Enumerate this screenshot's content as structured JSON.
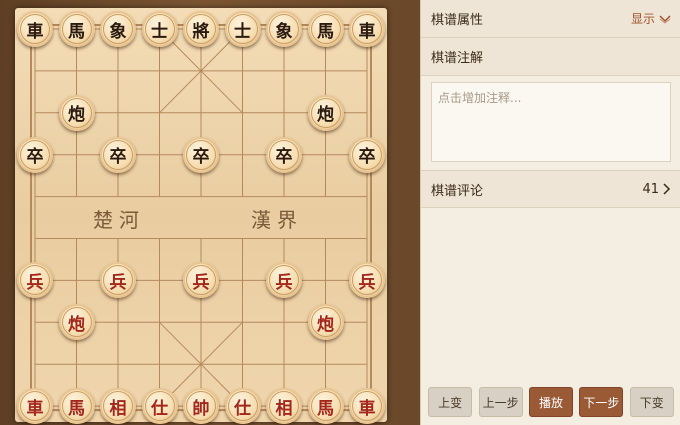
{
  "board": {
    "river_left": "楚河",
    "river_right": "漢界",
    "pieces": [
      {
        "char": "車",
        "side": "black",
        "col": 0,
        "row": 0
      },
      {
        "char": "馬",
        "side": "black",
        "col": 1,
        "row": 0
      },
      {
        "char": "象",
        "side": "black",
        "col": 2,
        "row": 0
      },
      {
        "char": "士",
        "side": "black",
        "col": 3,
        "row": 0
      },
      {
        "char": "將",
        "side": "black",
        "col": 4,
        "row": 0
      },
      {
        "char": "士",
        "side": "black",
        "col": 5,
        "row": 0
      },
      {
        "char": "象",
        "side": "black",
        "col": 6,
        "row": 0
      },
      {
        "char": "馬",
        "side": "black",
        "col": 7,
        "row": 0
      },
      {
        "char": "車",
        "side": "black",
        "col": 8,
        "row": 0
      },
      {
        "char": "炮",
        "side": "black",
        "col": 1,
        "row": 2
      },
      {
        "char": "炮",
        "side": "black",
        "col": 7,
        "row": 2
      },
      {
        "char": "卒",
        "side": "black",
        "col": 0,
        "row": 3
      },
      {
        "char": "卒",
        "side": "black",
        "col": 2,
        "row": 3
      },
      {
        "char": "卒",
        "side": "black",
        "col": 4,
        "row": 3
      },
      {
        "char": "卒",
        "side": "black",
        "col": 6,
        "row": 3
      },
      {
        "char": "卒",
        "side": "black",
        "col": 8,
        "row": 3
      },
      {
        "char": "兵",
        "side": "red",
        "col": 0,
        "row": 6
      },
      {
        "char": "兵",
        "side": "red",
        "col": 2,
        "row": 6
      },
      {
        "char": "兵",
        "side": "red",
        "col": 4,
        "row": 6
      },
      {
        "char": "兵",
        "side": "red",
        "col": 6,
        "row": 6
      },
      {
        "char": "兵",
        "side": "red",
        "col": 8,
        "row": 6
      },
      {
        "char": "炮",
        "side": "red",
        "col": 1,
        "row": 7
      },
      {
        "char": "炮",
        "side": "red",
        "col": 7,
        "row": 7
      },
      {
        "char": "車",
        "side": "red",
        "col": 0,
        "row": 9
      },
      {
        "char": "馬",
        "side": "red",
        "col": 1,
        "row": 9
      },
      {
        "char": "相",
        "side": "red",
        "col": 2,
        "row": 9
      },
      {
        "char": "仕",
        "side": "red",
        "col": 3,
        "row": 9
      },
      {
        "char": "帥",
        "side": "red",
        "col": 4,
        "row": 9
      },
      {
        "char": "仕",
        "side": "red",
        "col": 5,
        "row": 9
      },
      {
        "char": "相",
        "side": "red",
        "col": 6,
        "row": 9
      },
      {
        "char": "馬",
        "side": "red",
        "col": 7,
        "row": 9
      },
      {
        "char": "車",
        "side": "red",
        "col": 8,
        "row": 9
      }
    ]
  },
  "panel": {
    "properties_label": "棋谱属性",
    "show_label": "显示",
    "notes_label": "棋谱注解",
    "notes_placeholder": "点击增加注释...",
    "comments_label": "棋谱评论",
    "comments_count": "41",
    "buttons": {
      "prev_variation": "上变",
      "prev_step": "上一步",
      "play": "播放",
      "next_step": "下一步",
      "next_variation": "下变"
    }
  },
  "colors": {
    "red_piece_text": "#a3271b",
    "black_piece_text": "#2b1a0e",
    "accent": "#9a5a35"
  }
}
